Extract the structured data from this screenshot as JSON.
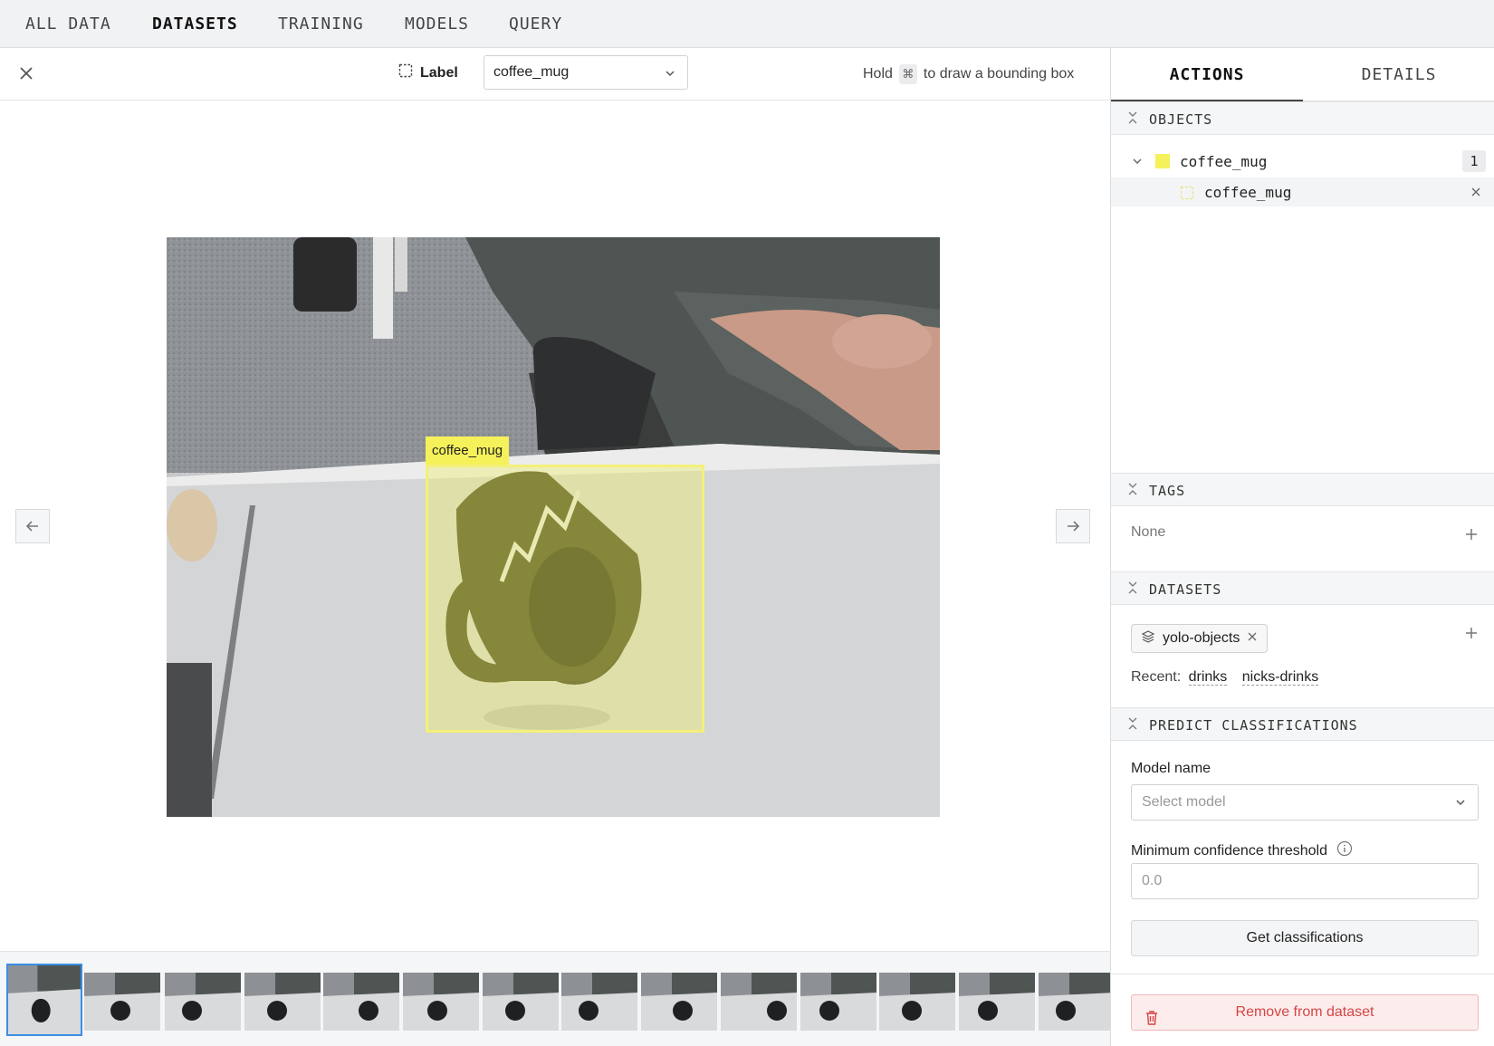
{
  "nav": {
    "items": [
      {
        "label": "ALL DATA"
      },
      {
        "label": "DATASETS",
        "active": true
      },
      {
        "label": "TRAINING"
      },
      {
        "label": "MODELS"
      },
      {
        "label": "QUERY"
      }
    ]
  },
  "toolbar": {
    "label_text": "Label",
    "selected_label": "coffee_mug",
    "hint_prefix": "Hold",
    "hint_key": "⌘",
    "hint_suffix": "to draw a bounding box"
  },
  "annotation": {
    "label": "coffee_mug",
    "color": "#f5f15a"
  },
  "side": {
    "tabs": [
      {
        "label": "ACTIONS",
        "active": true
      },
      {
        "label": "DETAILS"
      }
    ],
    "objects": {
      "title": "OBJECTS",
      "group_label": "coffee_mug",
      "group_count": "1",
      "item_label": "coffee_mug"
    },
    "tags": {
      "title": "TAGS",
      "value": "None"
    },
    "datasets": {
      "title": "DATASETS",
      "chip_label": "yolo-objects",
      "recent_label": "Recent:",
      "recent": [
        "drinks",
        "nicks-drinks"
      ]
    },
    "predict": {
      "title": "PREDICT CLASSIFICATIONS",
      "model_label": "Model name",
      "model_placeholder": "Select model",
      "threshold_label": "Minimum confidence threshold",
      "threshold_value": "0.0",
      "button": "Get classifications"
    },
    "remove_button": "Remove from dataset"
  },
  "colors": {
    "accent": "#3a8ee6",
    "bbox": "#f5f15a",
    "danger": "#d64545"
  }
}
